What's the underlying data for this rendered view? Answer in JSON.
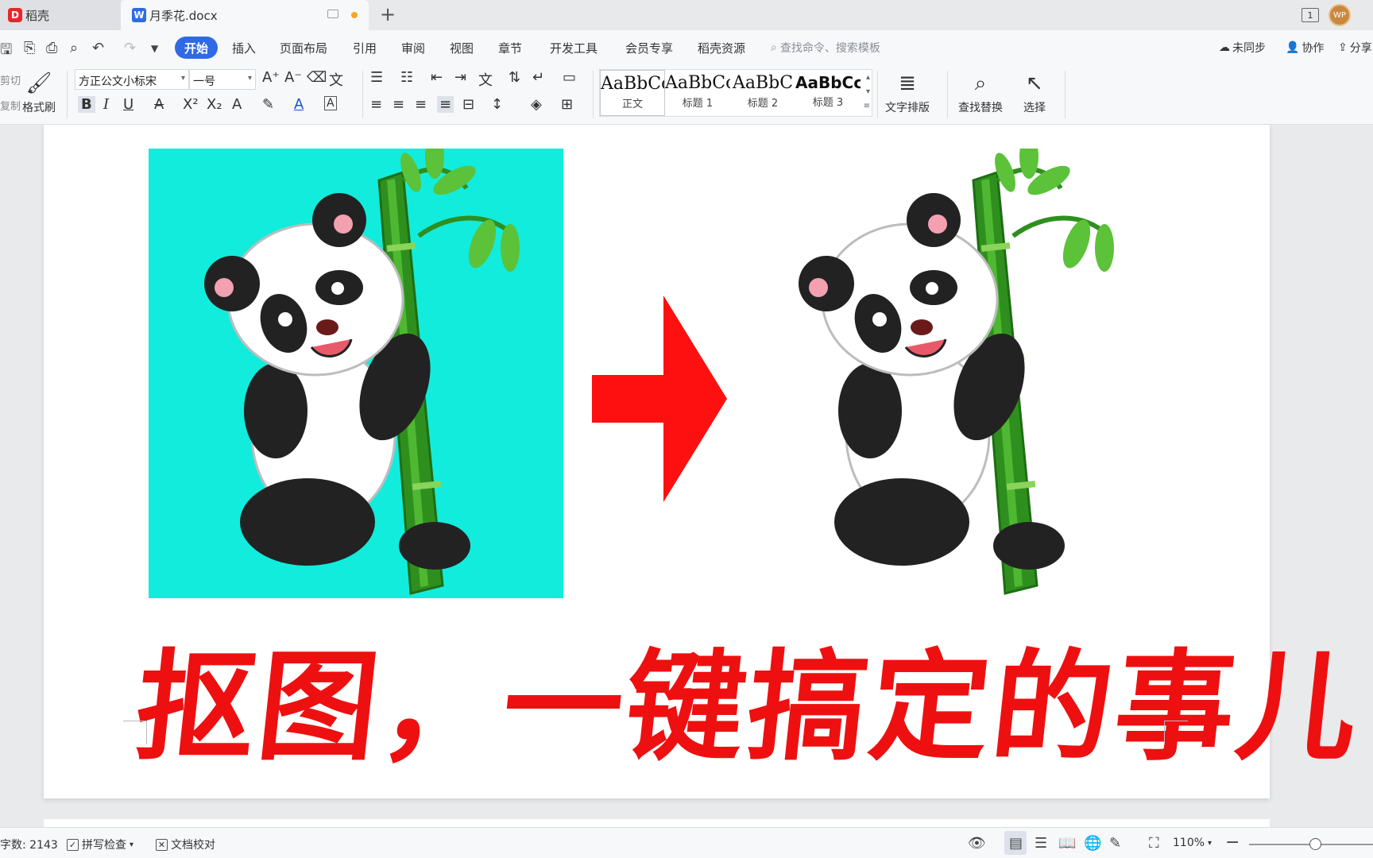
{
  "tabs": {
    "home_label": "稻壳",
    "doc_label": "月季花.docx",
    "window_count": "1",
    "avatar_text": "WP"
  },
  "menu": {
    "items": [
      "开始",
      "插入",
      "页面布局",
      "引用",
      "审阅",
      "视图",
      "章节",
      "开发工具",
      "会员专享",
      "稻壳资源"
    ],
    "search_placeholder": "查找命令、搜索模板",
    "sync": "未同步",
    "collab": "协作",
    "share": "分享"
  },
  "ribbon": {
    "cut": "剪切",
    "copy": "复制",
    "format_painter": "格式刷",
    "font_name": "方正公文小标宋",
    "font_size": "一号",
    "styles": [
      {
        "preview": "AaBbCcD",
        "name": "正文"
      },
      {
        "preview": "AaBbCcD",
        "name": "标题 1"
      },
      {
        "preview": "AaBbC",
        "name": "标题 2"
      },
      {
        "preview": "AaBbCcI",
        "name": "标题 3"
      }
    ],
    "text_layout": "文字排版",
    "find_replace": "查找替换",
    "select": "选择"
  },
  "document": {
    "headline": "抠图，一键搞定的事儿"
  },
  "status": {
    "word_count": "字数: 2143",
    "spell_check": "拼写检查",
    "doc_check": "文档校对",
    "zoom": "110%"
  },
  "colors": {
    "accent": "#2f6ae6",
    "headline_red": "#ee1010",
    "cyan_bg": "#12ecdc"
  }
}
